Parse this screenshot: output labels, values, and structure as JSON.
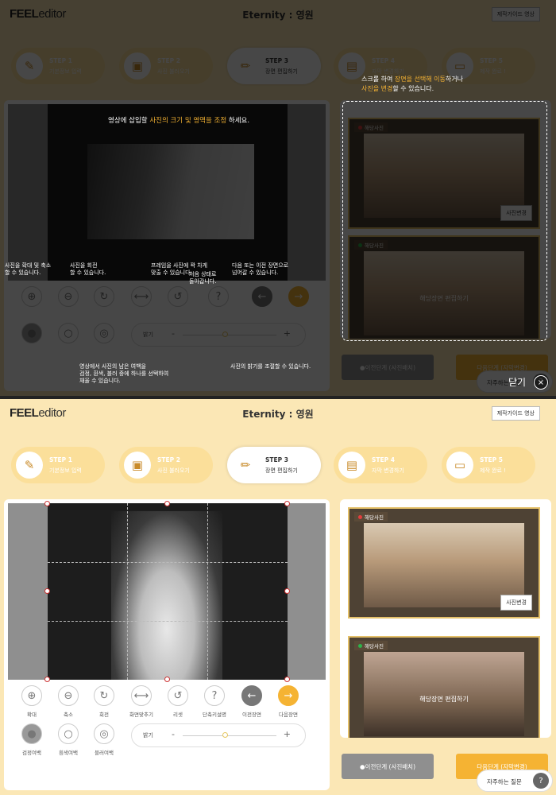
{
  "app": {
    "logo_bold": "FEEL",
    "logo_rest": "editor",
    "title": "Eternity : 영원",
    "guide_button": "제작가이드 영상"
  },
  "steps": [
    {
      "num": "STEP 1",
      "label": "기본정보 입력",
      "icon": "brush-icon"
    },
    {
      "num": "STEP 2",
      "label": "사진 불러오기",
      "icon": "image-icon"
    },
    {
      "num": "STEP 3",
      "label": "장면 편집하기",
      "icon": "pencil-icon"
    },
    {
      "num": "STEP 4",
      "label": "자막 변경하기",
      "icon": "film-icon"
    },
    {
      "num": "STEP 5",
      "label": "제작 완료 !",
      "icon": "monitor-icon"
    }
  ],
  "tools_row1": [
    {
      "label": "확대",
      "icon": "zoom-in-icon",
      "glyph": "⊕"
    },
    {
      "label": "축소",
      "icon": "zoom-out-icon",
      "glyph": "⊖"
    },
    {
      "label": "회전",
      "icon": "rotate-icon",
      "glyph": "↻"
    },
    {
      "label": "화면맞추기",
      "icon": "fit-screen-icon",
      "glyph": "⟷"
    },
    {
      "label": "리셋",
      "icon": "reset-icon",
      "glyph": "↺"
    },
    {
      "label": "단축키설명",
      "icon": "help-icon",
      "glyph": "?"
    },
    {
      "label": "이전장면",
      "icon": "arrow-left-icon",
      "glyph": "←"
    },
    {
      "label": "다음장면",
      "icon": "arrow-right-icon",
      "glyph": "→"
    }
  ],
  "tools_row2": [
    {
      "label": "검정여백",
      "icon": "black-margin-icon"
    },
    {
      "label": "흰색여백",
      "icon": "white-margin-icon"
    },
    {
      "label": "블러여백",
      "icon": "blur-margin-icon"
    }
  ],
  "brightness": {
    "label": "밝기",
    "minus": "-",
    "plus": "+",
    "level": 0.45
  },
  "scenes": [
    {
      "tag": "해당사진",
      "button": "사진변경",
      "tag_color": "#e43d3d"
    },
    {
      "tag": "해당사진",
      "edit_text": "해당장면 편집하기",
      "tag_color": "#2db34a"
    }
  ],
  "buttons": {
    "prev": "이전단계",
    "prev_sub": "(사진배치)",
    "next": "다음단계",
    "next_sub": "(자막변경)"
  },
  "faq": {
    "label": "자주하는 질문",
    "icon": "?"
  },
  "overlay": {
    "canvas_hint_pre": "영상에 삽입할 ",
    "canvas_hint_hl": "사진의 크기 및 영역을 조정",
    "canvas_hint_post": " 하세요.",
    "scene_hint_1_pre": "스크롤 하여 ",
    "scene_hint_1_hl": "장면을 선택해 이동",
    "scene_hint_1_post": "하거나",
    "scene_hint_2_hl": "사진을 변경",
    "scene_hint_2_post": "할 수 있습니다.",
    "tip_zoom": "사진을 확대 및 축소\n할 수 있습니다.",
    "tip_rotate": "사진을 회전\n할 수 있습니다.",
    "tip_fit": "프레임을 사진에 꽉 차게\n맞출 수 있습니다.",
    "tip_reset": "처음 상태로\n돌아갑니다.",
    "tip_nav": "다음 또는 이전 장면으로\n넘어갈 수 있습니다.",
    "tip_margin": "영상에서 사진의 남은 여백을\n검정, 흰색, 블러 중에 하나를 선택하여\n채울 수 있습니다.",
    "tip_bright": "사진의 밝기를 조절할 수 있습니다.",
    "close": "닫기",
    "close_icon": "×"
  }
}
